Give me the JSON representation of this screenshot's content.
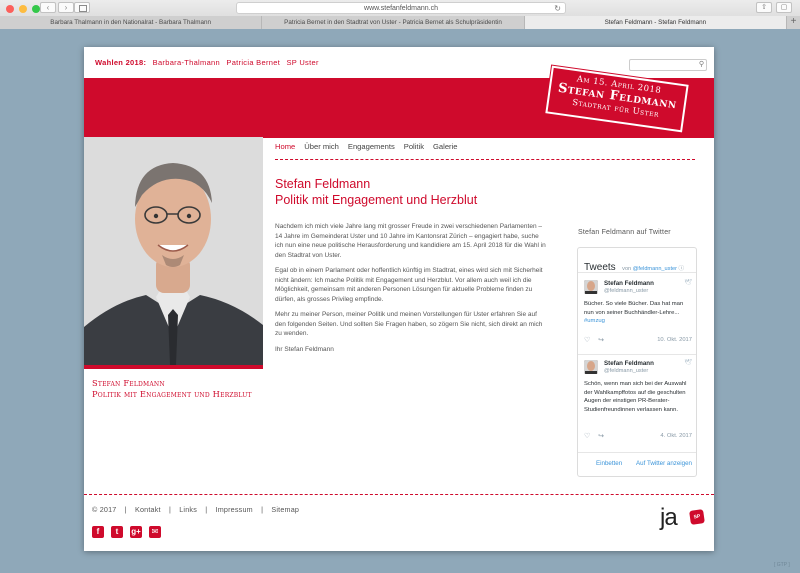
{
  "browser": {
    "url": "www.stefanfeldmann.ch",
    "tabs": [
      {
        "label": "Barbara Thalmann in den Nationalrat - Barbara Thalmann",
        "active": false
      },
      {
        "label": "Patricia Bernet in den Stadtrat von Uster - Patricia Bernet als Schulpräsidentin",
        "active": false
      },
      {
        "label": "Stefan Feldmann - Stefan Feldmann",
        "active": true
      }
    ],
    "new_tab": "+"
  },
  "header": {
    "wahlen_label": "Wahlen 2018:",
    "links": [
      "Barbara-Thalmann",
      "Patricia Bernet",
      "SP Uster"
    ],
    "search_placeholder": ""
  },
  "stamp": {
    "date": "Am 15. April 2018",
    "name": "Stefan Feldmann",
    "office": "Stadtrat für Uster"
  },
  "caption": {
    "line1": "Stefan Feldmann",
    "line2": "Politik mit Engagement und Herzblut"
  },
  "nav": {
    "items": [
      "Home",
      "Über mich",
      "Engagements",
      "Politik",
      "Galerie"
    ],
    "active": "Home"
  },
  "main": {
    "title_line1": "Stefan Feldmann",
    "title_line2": "Politik mit Engagement und Herzblut",
    "paragraphs": [
      "Nachdem ich mich viele Jahre lang mit grosser Freude in zwei verschiedenen Parlamenten – 14 Jahre im Gemeinderat Uster und 10 Jahre im Kantonsrat Zürich – engagiert habe, suche ich nun eine neue politische Herausforderung und kandidiere am 15. April 2018 für die Wahl in den Stadtrat von Uster.",
      "Egal ob in einem Parlament oder hoffentlich künftig im Stadtrat, eines wird sich mit Sicherheit nicht ändern: Ich mache Politik mit Engagement und Herzblut. Vor allem auch weil ich die Möglichkeit, gemeinsam mit anderen Personen Lösungen für aktuelle Probleme finden zu dürfen, als grosses Privileg empfinde.",
      "Mehr zu meiner Person, meiner Politik und meinen Vorstellungen für Uster erfahren Sie auf den folgenden Seiten. Und sollten Sie Fragen haben, so zögern Sie nicht, sich direkt an mich zu wenden.",
      "Ihr Stefan Feldmann"
    ]
  },
  "twitter": {
    "heading": "Stefan Feldmann auf Twitter",
    "tweets_label": "Tweets",
    "by_prefix": "von",
    "by_handle": "@feldmann_uster",
    "tweets": [
      {
        "name": "Stefan Feldmann",
        "handle": "@feldmann_uster",
        "text": "Bücher. So viele Bücher. Das hat man nun von seiner Buchhändler-Lehre...",
        "hashtag": "#umzug",
        "date": "10. Okt. 2017"
      },
      {
        "name": "Stefan Feldmann",
        "handle": "@feldmann_uster",
        "text": "Schön, wenn man sich bei der Auswahl der Wahlkampffotos auf die geschulten Augen der einstigen PR-Berater-Studienfreundinnen verlassen kann.",
        "hashtag": "",
        "date": "4. Okt. 2017"
      }
    ],
    "embed_label": "Einbetten",
    "view_label": "Auf Twitter anzeigen"
  },
  "footer": {
    "copyright": "© 2017",
    "links": [
      "Kontakt",
      "Links",
      "Impressum",
      "Sitemap"
    ],
    "separator": "|",
    "social_icons": [
      "facebook-icon",
      "twitter-icon",
      "google-plus-icon",
      "email-icon"
    ],
    "logo_text": "ja",
    "logo_badge": "SP"
  },
  "gtp": "[ GTP ]",
  "colors": {
    "accent": "#cf0a2c",
    "background": "#8fa8b9",
    "link_blue": "#3b94d9"
  }
}
